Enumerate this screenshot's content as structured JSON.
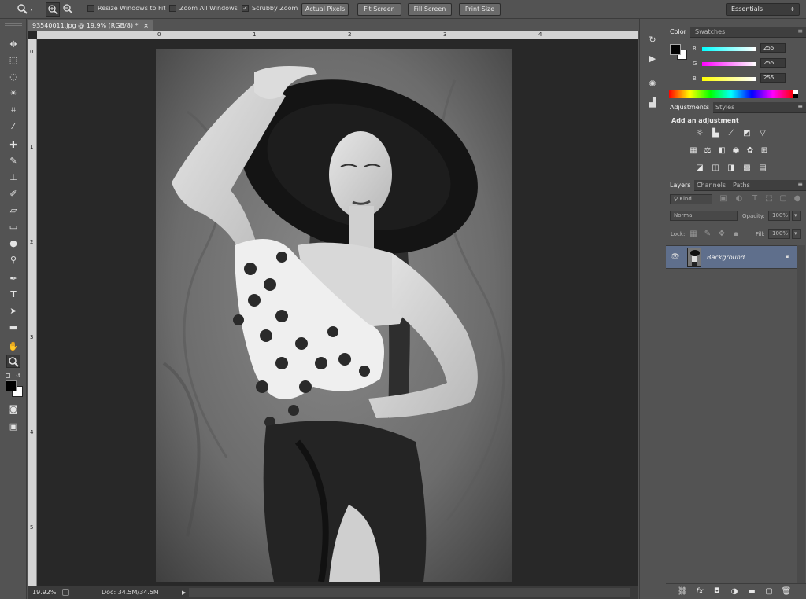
{
  "options_bar": {
    "resize_windows_label": "Resize Windows to Fit",
    "zoom_all_label": "Zoom All Windows",
    "scrubby_zoom_label": "Scrubby Zoom",
    "actual_pixels_label": "Actual Pixels",
    "fit_screen_label": "Fit Screen",
    "fill_screen_label": "Fill Screen",
    "print_size_label": "Print Size",
    "workspace_label": "Essentials"
  },
  "document": {
    "tab_title": "93540011.jpg @ 19.9% (RGB/8) *",
    "tab_close": "×",
    "zoom_level": "19.92%",
    "doc_size": "Doc: 34.5M/34.5M",
    "ruler_top": [
      "0",
      "1",
      "2",
      "3",
      "4"
    ],
    "ruler_left": [
      "0",
      "1",
      "2",
      "3",
      "4",
      "5"
    ]
  },
  "color_panel": {
    "tab_color": "Color",
    "tab_swatches": "Swatches",
    "r_label": "R",
    "g_label": "G",
    "b_label": "B",
    "r_value": "255",
    "g_value": "255",
    "b_value": "255"
  },
  "adjustments_panel": {
    "tab_adjustments": "Adjustments",
    "tab_styles": "Styles",
    "heading": "Add an adjustment"
  },
  "layers_panel": {
    "tab_layers": "Layers",
    "tab_channels": "Channels",
    "tab_paths": "Paths",
    "kind_label": "Kind",
    "blend_mode": "Normal",
    "opacity_label": "Opacity:",
    "opacity_value": "100%",
    "lock_label": "Lock:",
    "fill_label": "Fill:",
    "fill_value": "100%",
    "layer_name": "Background"
  },
  "colors": {
    "panel_bg": "#535353",
    "canvas_bg": "#282828",
    "layer_selected": "#5f6f8c"
  }
}
